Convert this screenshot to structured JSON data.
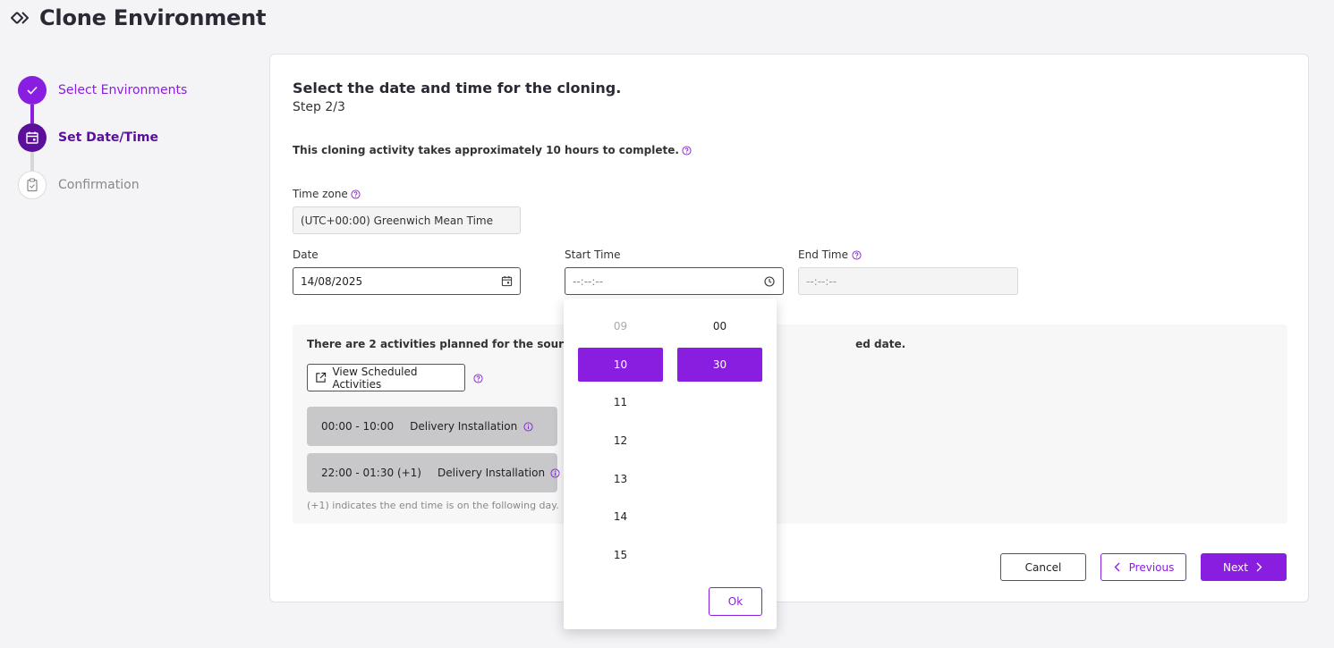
{
  "header": {
    "title": "Clone Environment"
  },
  "stepper": {
    "steps": [
      {
        "label": "Select Environments",
        "state": "done"
      },
      {
        "label": "Set Date/Time",
        "state": "active"
      },
      {
        "label": "Confirmation",
        "state": "pending"
      }
    ]
  },
  "content": {
    "title": "Select the date and time for the cloning.",
    "step": "Step 2/3",
    "info": "This cloning activity takes approximately 10 hours to complete."
  },
  "form": {
    "timezone_label": "Time zone",
    "timezone_value": "(UTC+00:00) Greenwich Mean Time",
    "date_label": "Date",
    "date_value": "14/08/2025",
    "start_label": "Start Time",
    "start_placeholder": "--:--:--",
    "end_label": "End Time",
    "end_placeholder": "--:--:--"
  },
  "activities": {
    "notice_before": "There are 2 activities  planned for the source an",
    "notice_after": "ed date.",
    "view_button": "View Scheduled Activities",
    "items": [
      {
        "time": "00:00 - 10:00",
        "name": "Delivery Installation"
      },
      {
        "time": "22:00 - 01:30 (+1)",
        "name": "Delivery Installation"
      }
    ],
    "footnote": "(+1) indicates the end time is on the following day."
  },
  "buttons": {
    "cancel": "Cancel",
    "previous": "Previous",
    "next": "Next"
  },
  "time_picker": {
    "hours": [
      "09",
      "10",
      "11",
      "12",
      "13",
      "14",
      "15"
    ],
    "selected_hour": "10",
    "minutes": [
      "00",
      "30"
    ],
    "selected_minute": "30",
    "ok": "Ok"
  },
  "colors": {
    "accent": "#8a1ee0",
    "accent_dark": "#5b0f9b",
    "activity_bg": "#c8c8cb"
  }
}
